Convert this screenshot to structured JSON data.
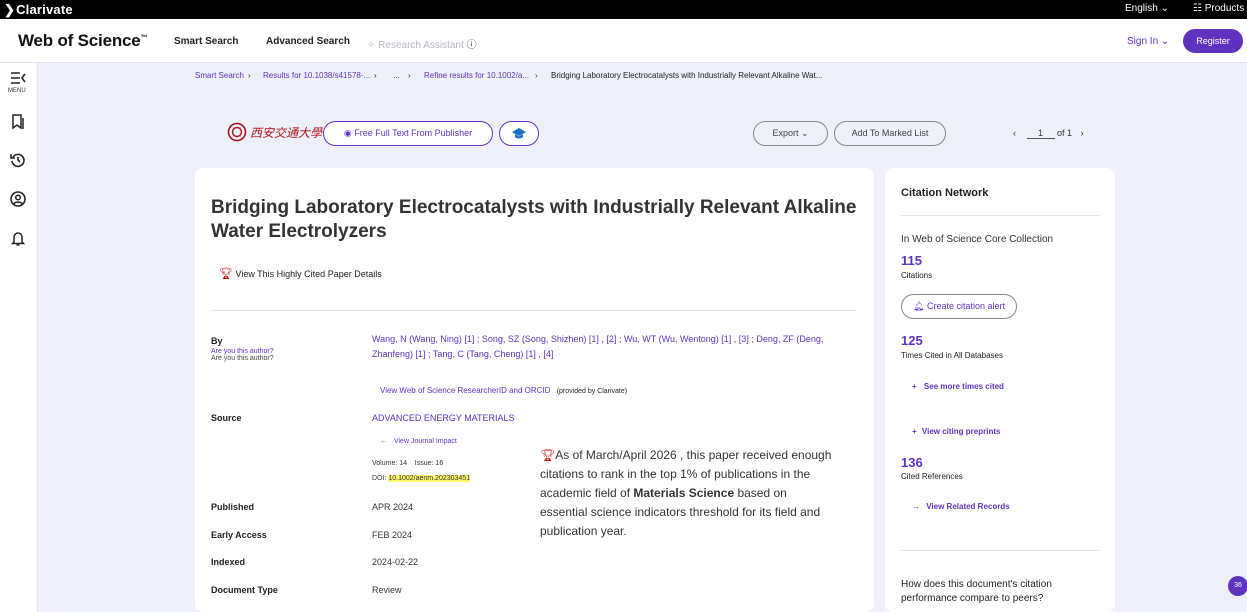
{
  "topbar": {
    "brand": "Clarivate",
    "language": "English",
    "products": "Products"
  },
  "header": {
    "logo": "Web of Science",
    "logo_tm": "™",
    "nav": [
      "Smart Search",
      "Advanced Search",
      "Research Assistant"
    ],
    "sign_in": "Sign In",
    "register": "Register"
  },
  "leftrail": {
    "menu_label": "MENU"
  },
  "breadcrumb": {
    "items": [
      "Smart Search",
      "Results for 10.1038/s41578-...",
      "...",
      "Refine results for 10.1002/a...",
      "Bridging Laboratory Electrocatalysts with Industrially Relevant Alkaline Wat..."
    ]
  },
  "toolbar": {
    "university_logo_text": "西安交通大學",
    "free_full_text": "Free Full Text From Publisher",
    "export": "Export",
    "add_to_marked_list": "Add To Marked List",
    "page_current": "1",
    "page_of": "of 1"
  },
  "record": {
    "title": "Bridging Laboratory Electrocatalysts with Industrially Relevant Alkaline Water Electrolyzers",
    "highly_cited_link": "View This Highly Cited Paper Details",
    "by_label": "By",
    "are_you_author": "Are you this author?",
    "authors_line1": "Wang, N (Wang, Ning) [1] ; Song, SZ (Song, Shizhen) [1] , [2] ; Wu, WT (Wu, Wentong) [1] , [3] ; Deng, ZF (Deng,",
    "authors_line2": "Zhanfeng) [1] ; Tang, C (Tang, Cheng) [1] , [4]",
    "researcher_id_link": "View Web of Science ResearcherID and ORCID",
    "provided_by": "(provided by Clarivate)",
    "source_label": "Source",
    "source_value": "ADVANCED ENERGY MATERIALS",
    "journal_impact": "View Journal Impact",
    "volume_issue": "Volume: 14    Issue: 16",
    "doi_label": "DOI:",
    "doi_value": "10.1002/aenm.202303451",
    "published_label": "Published",
    "published_value": "APR 2024",
    "early_access_label": "Early Access",
    "early_access_value": "FEB 2024",
    "indexed_label": "Indexed",
    "indexed_value": "2024-02-22",
    "doctype_label": "Document Type",
    "doctype_value": "Review",
    "hc_note_line1": "As of March/April 2026 , this paper received enough",
    "hc_note_line2": "citations to rank in the top 1% of publications in the",
    "hc_note_line3a": "academic field of ",
    "hc_note_line3b": "Materials Science",
    "hc_note_line3c": " based on",
    "hc_note_line4": "essential science indicators threshold for its field and",
    "hc_note_line5": "publication year."
  },
  "citation_network": {
    "title": "Citation Network",
    "collection": "In Web of Science Core Collection",
    "citations_count": "115",
    "citations_label": "Citations",
    "create_alert": "Create citation alert",
    "times_cited_all": "125",
    "times_cited_all_label": "Times Cited in All Databases",
    "see_more": "See more times cited",
    "view_preprints": "View citing preprints",
    "cited_refs": "136",
    "cited_refs_label": "Cited References",
    "view_related": "View Related Records",
    "compare_line1": "How does this document's citation",
    "compare_line2": "performance compare to peers?"
  },
  "chat_bubble": {
    "count": "36"
  },
  "colors": {
    "brand": "#5e33bf",
    "highlight": "#fff56b",
    "trophy": "#c0160c"
  }
}
